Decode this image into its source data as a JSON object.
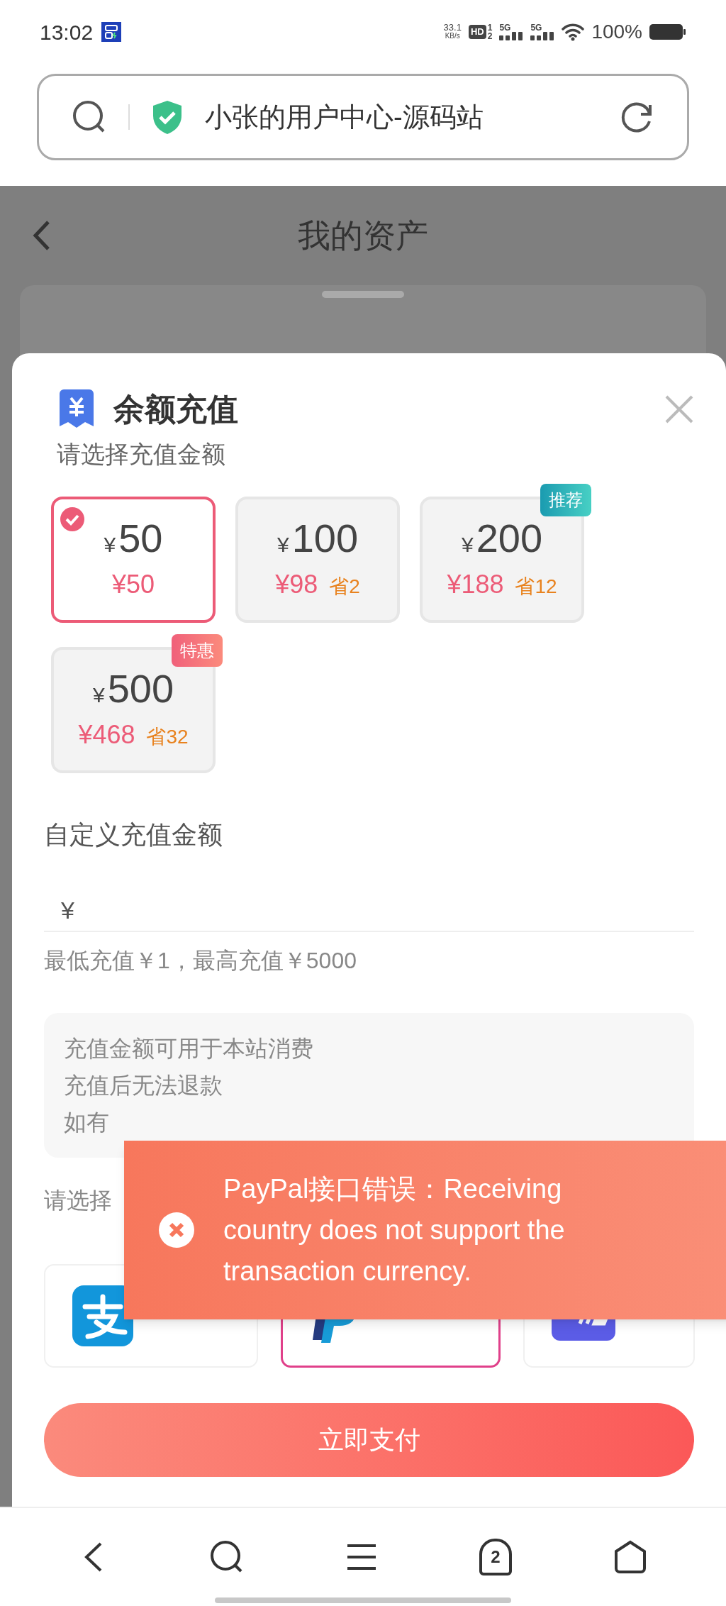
{
  "status_bar": {
    "time": "13:02",
    "net_speed": "33.1",
    "net_unit": "KB/s",
    "hd": "HD",
    "sims": [
      "1",
      "2"
    ],
    "signals": [
      "5G",
      "5G"
    ],
    "battery": "100%"
  },
  "address_bar": {
    "title": "小张的用户中心-源码站"
  },
  "page_header": {
    "title": "我的资产"
  },
  "sheet": {
    "title": "余额充值",
    "section_label": "请选择充值金额",
    "options": [
      {
        "currency": "¥",
        "amount": "50",
        "price": "¥50",
        "selected": true
      },
      {
        "currency": "¥",
        "amount": "100",
        "price": "¥98",
        "saving": "省2",
        "selected": false
      },
      {
        "currency": "¥",
        "amount": "200",
        "price": "¥188",
        "saving": "省12",
        "selected": false,
        "badge": {
          "text": "推荐",
          "kind": "recommend"
        }
      },
      {
        "currency": "¥",
        "amount": "500",
        "price": "¥468",
        "saving": "省32",
        "selected": false,
        "badge": {
          "text": "特惠",
          "kind": "deal"
        }
      }
    ],
    "custom_amount": {
      "label": "自定义充值金额",
      "currency": "¥",
      "hint": "最低充值￥1，最高充值￥5000"
    },
    "notes": [
      "充值金额可用于本站消费",
      "充值后无法退款",
      "如有"
    ],
    "payment_label": "请选择",
    "payment_methods": [
      {
        "kind": "alipay",
        "selected": false
      },
      {
        "kind": "paypal",
        "selected": true
      },
      {
        "kind": "card",
        "selected": false
      }
    ],
    "pay_button": "立即支付"
  },
  "toast": {
    "message": "PayPal接口错误：Receiving country does not support the transaction currency."
  },
  "nav_bar": {
    "tabs_count": "2"
  }
}
